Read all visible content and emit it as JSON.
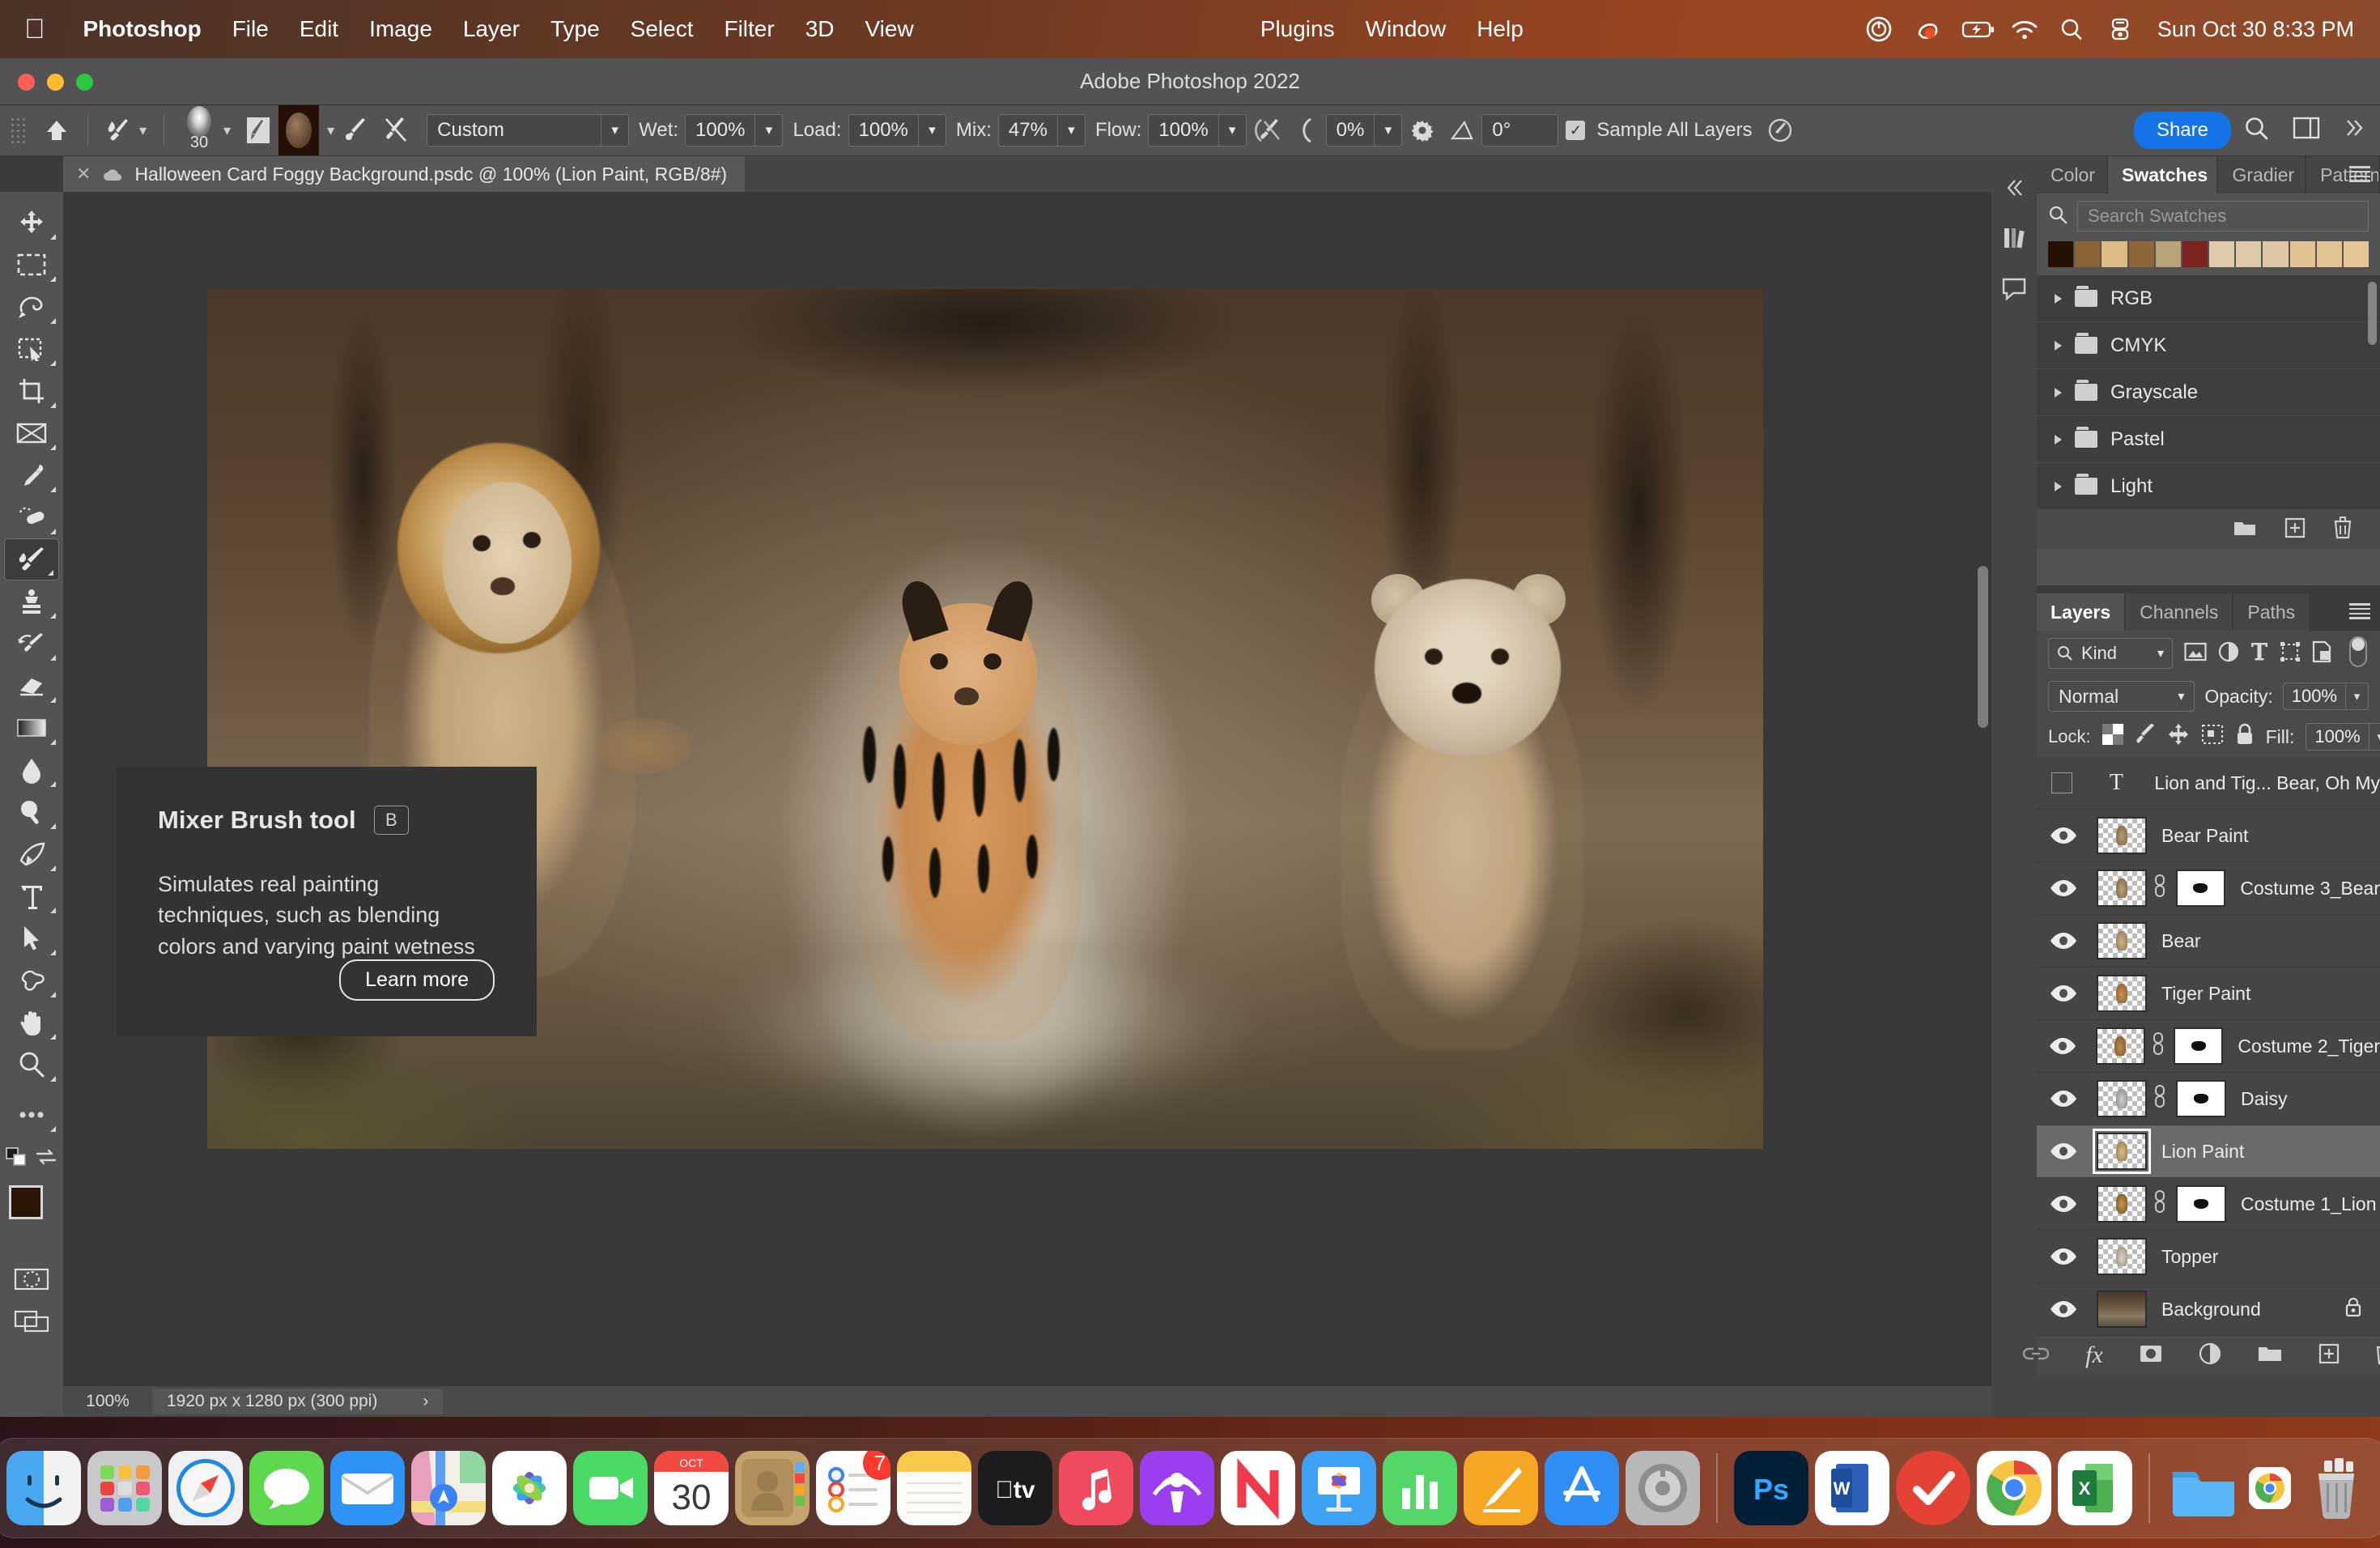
{
  "menubar": {
    "apple_icon": "apple-logo-icon",
    "items": [
      {
        "label": "Photoshop",
        "bold": true
      },
      {
        "label": "File",
        "bold": false
      },
      {
        "label": "Edit",
        "bold": false
      },
      {
        "label": "Image",
        "bold": false
      },
      {
        "label": "Layer",
        "bold": false
      },
      {
        "label": "Type",
        "bold": false
      },
      {
        "label": "Select",
        "bold": false
      },
      {
        "label": "Filter",
        "bold": false
      },
      {
        "label": "3D",
        "bold": false
      },
      {
        "label": "View",
        "bold": false
      }
    ],
    "right_items": [
      {
        "label": "Plugins"
      },
      {
        "label": "Window"
      },
      {
        "label": "Help"
      }
    ],
    "status_icons": [
      "screen-record-icon",
      "clipboard-icon",
      "battery-charging-icon",
      "wifi-icon",
      "search-icon",
      "control-center-icon"
    ],
    "clock": "Sun Oct 30  8:33 PM"
  },
  "window": {
    "title": "Adobe Photoshop 2022",
    "traffic_lights": [
      "close-button",
      "minimize-button",
      "zoom-button"
    ],
    "traffic_colors": [
      "#ff5f57",
      "#febc2e",
      "#28c840"
    ]
  },
  "options_bar": {
    "home_icon": "home-icon",
    "tool_preset_icon": "mixer-brush-preset-icon",
    "brush_size": "30",
    "brush_preset_icon": "brush-preset-picker-icon",
    "load_brush_icon": "load-brush-icon",
    "clean_brush_icon": "clean-brush-icon",
    "current_swatch": "#6b4f35",
    "blend_preset": "Custom",
    "wet_label": "Wet:",
    "wet_value": "100%",
    "load_label": "Load:",
    "load_value": "100%",
    "mix_label": "Mix:",
    "mix_value": "47%",
    "flow_label": "Flow:",
    "flow_value": "100%",
    "airbrush_icon": "airbrush-icon",
    "smoothing_icon": "smoothing-icon",
    "smoothing_value": "0%",
    "smoothing_options_icon": "gear-icon",
    "angle_icon": "angle-icon",
    "angle_value": "0°",
    "sample_all_layers_label": "Sample All Layers",
    "sample_all_layers_checked": true,
    "pressure_icon": "tablet-pressure-icon",
    "share_label": "Share",
    "share_color": "#1473e6",
    "search_icon": "search-icon",
    "workspace_icon": "workspace-icon",
    "overflow_icon": "chevron-double-right-icon"
  },
  "document_tab": {
    "close_icon": "close-icon",
    "file_icon": "psd-cloud-icon",
    "title": "Halloween Card Foggy Background.psdc @ 100% (Lion Paint, RGB/8#)"
  },
  "toolbar": {
    "tools": [
      {
        "name": "move-tool",
        "selected": false
      },
      {
        "name": "rectangular-marquee-tool",
        "selected": false
      },
      {
        "name": "lasso-tool",
        "selected": false
      },
      {
        "name": "object-selection-tool",
        "selected": false
      },
      {
        "name": "crop-tool",
        "selected": false
      },
      {
        "name": "frame-tool",
        "selected": false
      },
      {
        "name": "eyedropper-tool",
        "selected": false
      },
      {
        "name": "spot-healing-brush-tool",
        "selected": false
      },
      {
        "name": "mixer-brush-tool",
        "selected": true
      },
      {
        "name": "clone-stamp-tool",
        "selected": false
      },
      {
        "name": "history-brush-tool",
        "selected": false
      },
      {
        "name": "eraser-tool",
        "selected": false
      },
      {
        "name": "gradient-tool",
        "selected": false
      },
      {
        "name": "blur-tool",
        "selected": false
      },
      {
        "name": "dodge-tool",
        "selected": false
      },
      {
        "name": "pen-tool",
        "selected": false
      },
      {
        "name": "horizontal-type-tool",
        "selected": false
      },
      {
        "name": "path-selection-tool",
        "selected": false
      },
      {
        "name": "custom-shape-tool",
        "selected": false
      },
      {
        "name": "hand-tool",
        "selected": false
      },
      {
        "name": "zoom-tool",
        "selected": false
      },
      {
        "name": "edit-toolbar-tool",
        "selected": false
      }
    ],
    "foreground_color": "#2b1508",
    "background_color": "#ffffff",
    "swap_colors_icon": "swap-colors-icon",
    "default_colors_icon": "default-colors-icon",
    "quick_mask_icon": "quick-mask-icon",
    "screen_mode_icon": "screen-mode-icon"
  },
  "tooltip": {
    "title": "Mixer Brush tool",
    "shortcut": "B",
    "body": "Simulates real painting techniques, such as blending colors and varying paint wetness",
    "button": "Learn more"
  },
  "status_bar": {
    "zoom": "100%",
    "dimensions": "1920 px x 1280 px (300 ppi)",
    "expand_icon": "chevron-right-icon"
  },
  "rail": {
    "icons": [
      "libraries-icon",
      "comments-icon"
    ]
  },
  "swatches_panel": {
    "tabs": [
      {
        "label": "Color",
        "active": false
      },
      {
        "label": "Swatches",
        "active": true
      },
      {
        "label": "Gradier",
        "active": false
      },
      {
        "label": "Patterns",
        "active": false
      }
    ],
    "menu_icon": "panel-menu-icon",
    "search_icon": "search-icon",
    "search_placeholder": "Search Swatches",
    "recent_swatches": [
      "#251004",
      "#8a6336",
      "#dcbb84",
      "#8e6637",
      "#b9a378",
      "#7d2420",
      "#e0cbac",
      "#ddc9aa",
      "#dcc6a5",
      "#e0c293",
      "#e2c492",
      "#e3c694"
    ],
    "groups": [
      {
        "label": "RGB"
      },
      {
        "label": "CMYK"
      },
      {
        "label": "Grayscale"
      },
      {
        "label": "Pastel"
      },
      {
        "label": "Light"
      }
    ],
    "footer_icons": [
      "new-group-icon",
      "new-swatch-icon",
      "delete-swatch-icon"
    ]
  },
  "layers_panel": {
    "tabs": [
      {
        "label": "Layers",
        "active": true
      },
      {
        "label": "Channels",
        "active": false
      },
      {
        "label": "Paths",
        "active": false
      }
    ],
    "menu_icon": "panel-menu-icon",
    "filter_label": "Kind",
    "filter_icons": [
      "filter-pixel-icon",
      "filter-adjustment-icon",
      "filter-type-icon",
      "filter-shape-icon",
      "filter-smart-object-icon"
    ],
    "filter_toggle": "filter-enable-toggle",
    "blend_mode": "Normal",
    "opacity_label": "Opacity:",
    "opacity_value": "100%",
    "lock_label": "Lock:",
    "lock_icons": [
      "lock-transparent-pixels-icon",
      "lock-image-pixels-icon",
      "lock-position-icon",
      "lock-artboard-icon",
      "lock-all-icon"
    ],
    "fill_label": "Fill:",
    "fill_value": "100%",
    "layers": [
      {
        "name": "Lion and Tig... Bear, Oh My",
        "type": "text",
        "visible": false,
        "selected": false,
        "has_mask": false,
        "locked": false
      },
      {
        "name": "Bear Paint",
        "type": "pixel",
        "visible": true,
        "selected": false,
        "has_mask": false,
        "locked": false
      },
      {
        "name": "Costume 3_Bear",
        "type": "pixel",
        "visible": true,
        "selected": false,
        "has_mask": true,
        "locked": false
      },
      {
        "name": "Bear",
        "type": "pixel",
        "visible": true,
        "selected": false,
        "has_mask": false,
        "locked": false
      },
      {
        "name": "Tiger Paint",
        "type": "pixel",
        "visible": true,
        "selected": false,
        "has_mask": false,
        "locked": false
      },
      {
        "name": "Costume 2_Tiger",
        "type": "pixel",
        "visible": true,
        "selected": false,
        "has_mask": true,
        "locked": false
      },
      {
        "name": "Daisy",
        "type": "pixel",
        "visible": true,
        "selected": false,
        "has_mask": true,
        "locked": false
      },
      {
        "name": "Lion Paint",
        "type": "pixel",
        "visible": true,
        "selected": true,
        "has_mask": false,
        "locked": false
      },
      {
        "name": "Costume 1_Lion",
        "type": "pixel",
        "visible": true,
        "selected": false,
        "has_mask": true,
        "locked": false
      },
      {
        "name": "Topper",
        "type": "pixel",
        "visible": true,
        "selected": false,
        "has_mask": false,
        "locked": false
      },
      {
        "name": "Background",
        "type": "image",
        "visible": true,
        "selected": false,
        "has_mask": false,
        "locked": true
      }
    ],
    "footer_icons": [
      "link-layers-icon",
      "layer-style-fx-icon",
      "add-layer-mask-icon",
      "new-adjustment-layer-icon",
      "new-group-icon",
      "new-layer-icon",
      "delete-layer-icon"
    ]
  },
  "dock": {
    "items": [
      {
        "name": "finder-icon",
        "label": "Finder",
        "running": true
      },
      {
        "name": "launchpad-icon",
        "label": "Launchpad",
        "running": false
      },
      {
        "name": "safari-icon",
        "label": "Safari",
        "running": true
      },
      {
        "name": "messages-icon",
        "label": "Messages",
        "running": true
      },
      {
        "name": "mail-icon",
        "label": "Mail",
        "running": true
      },
      {
        "name": "maps-icon",
        "label": "Maps",
        "running": true
      },
      {
        "name": "photos-icon",
        "label": "Photos",
        "running": false
      },
      {
        "name": "facetime-icon",
        "label": "FaceTime",
        "running": false
      },
      {
        "name": "calendar-icon",
        "label": "Calendar",
        "running": false,
        "month": "OCT",
        "day": "30"
      },
      {
        "name": "contacts-icon",
        "label": "Contacts",
        "running": false
      },
      {
        "name": "reminders-icon",
        "label": "Reminders",
        "running": false,
        "badge": "7"
      },
      {
        "name": "notes-icon",
        "label": "Notes",
        "running": true
      },
      {
        "name": "apple-tv-icon",
        "label": "TV",
        "running": false
      },
      {
        "name": "music-icon",
        "label": "Music",
        "running": true
      },
      {
        "name": "podcasts-icon",
        "label": "Podcasts",
        "running": false
      },
      {
        "name": "news-icon",
        "label": "News",
        "running": true
      },
      {
        "name": "keynote-icon",
        "label": "Keynote",
        "running": false
      },
      {
        "name": "numbers-icon",
        "label": "Numbers",
        "running": false
      },
      {
        "name": "pages-icon",
        "label": "Pages",
        "running": false
      },
      {
        "name": "app-store-icon",
        "label": "App Store",
        "running": false
      },
      {
        "name": "system-preferences-icon",
        "label": "System Preferences",
        "running": false
      },
      {
        "name": "photoshop-icon",
        "label": "Ps",
        "running": true
      },
      {
        "name": "microsoft-word-icon",
        "label": "W",
        "running": true
      },
      {
        "name": "todoist-icon",
        "label": "Todoist",
        "running": true
      },
      {
        "name": "google-chrome-icon",
        "label": "Chrome",
        "running": true
      },
      {
        "name": "microsoft-excel-icon",
        "label": "X",
        "running": true
      },
      {
        "name": "downloads-folder-icon",
        "label": "Downloads",
        "running": false
      },
      {
        "name": "chrome-minimized-icon",
        "label": "Chrome window",
        "running": false
      },
      {
        "name": "trash-icon",
        "label": "Trash",
        "running": false
      }
    ]
  }
}
